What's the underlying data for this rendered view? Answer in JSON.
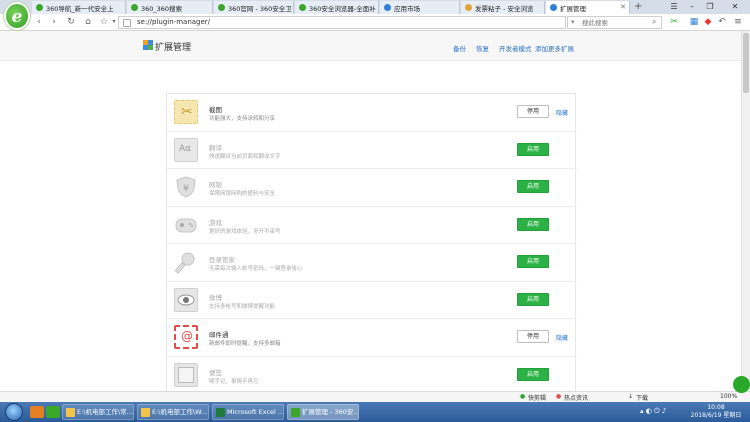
{
  "browser": {
    "tabs": [
      {
        "label": "360导航_新一代安全上",
        "icon_color": "#3aa72b"
      },
      {
        "label": "360_360搜索",
        "icon_color": "#3aa72b"
      },
      {
        "label": "360官网 - 360安全卫",
        "icon_color": "#3aa72b"
      },
      {
        "label": "360安全浏览器-全面补",
        "icon_color": "#3aa72b"
      },
      {
        "label": "应用市场",
        "icon_color": "#2f7fd8"
      },
      {
        "label": "发票粘子 - 安全浏览",
        "icon_color": "#e2a23b"
      },
      {
        "label": "扩展管理",
        "icon_color": "#2f7fd8"
      }
    ],
    "new_tab_symbol": "+",
    "address": "se://plugin-manager/",
    "search_placeholder": "搜此搜索"
  },
  "page": {
    "title": "扩展管理",
    "links": [
      "备份",
      "恢复",
      "开发者模式",
      "添加更多扩展"
    ]
  },
  "extensions": [
    {
      "name": "截图",
      "desc": "功能强大，支持涂鸦和分享",
      "button": "停用",
      "hide": "隐藏",
      "enabled": true,
      "icon": "scissors-icon",
      "color": "#f6e7b2"
    },
    {
      "name": "翻译",
      "desc": "快速翻译当前页面和翻译文字",
      "button": "启用",
      "enabled": false,
      "icon": "translate-icon",
      "color": "#e2e2e2"
    },
    {
      "name": "网银",
      "desc": "保障网银网购的便利与安全",
      "button": "启用",
      "enabled": false,
      "icon": "shield-yen-icon",
      "color": "#e2e2e2"
    },
    {
      "name": "游戏",
      "desc": "更好的游戏体验，多开不串号",
      "button": "启用",
      "enabled": false,
      "icon": "gamepad-icon",
      "color": "#e2e2e2"
    },
    {
      "name": "登录管家",
      "desc": "无需每次输入帐号密码，一键登录省心",
      "button": "启用",
      "enabled": false,
      "icon": "key-icon",
      "color": "#e2e2e2"
    },
    {
      "name": "微博",
      "desc": "支持多帐号和微博提醒功能",
      "button": "启用",
      "enabled": false,
      "icon": "eye-icon",
      "color": "#e2e2e2"
    },
    {
      "name": "邮件通",
      "desc": "新邮件即时提醒，支持多邮箱",
      "button": "停用",
      "hide": "隐藏",
      "enabled": true,
      "icon": "mail-at-icon",
      "color": "#e34b4b"
    },
    {
      "name": "便签",
      "desc": "随手记，事情不再忘",
      "button": "启用",
      "enabled": false,
      "icon": "note-icon",
      "color": "#e2e2e2"
    }
  ],
  "statusbar": {
    "items": [
      "快剪辑",
      "热点资讯",
      "下载",
      "100%"
    ]
  },
  "taskbar": {
    "items": [
      {
        "label": "E:\\机电部工作\\常...",
        "icon_color": "#f3c44a"
      },
      {
        "label": "E:\\机电部工作\\W...",
        "icon_color": "#f3c44a"
      },
      {
        "label": "Microsoft Excel ...",
        "icon_color": "#1f7a3e"
      },
      {
        "label": "扩展管理 - 360安...",
        "icon_color": "#3aa72b"
      }
    ],
    "time": "10:08",
    "date": "2018/6/19 星期日"
  }
}
